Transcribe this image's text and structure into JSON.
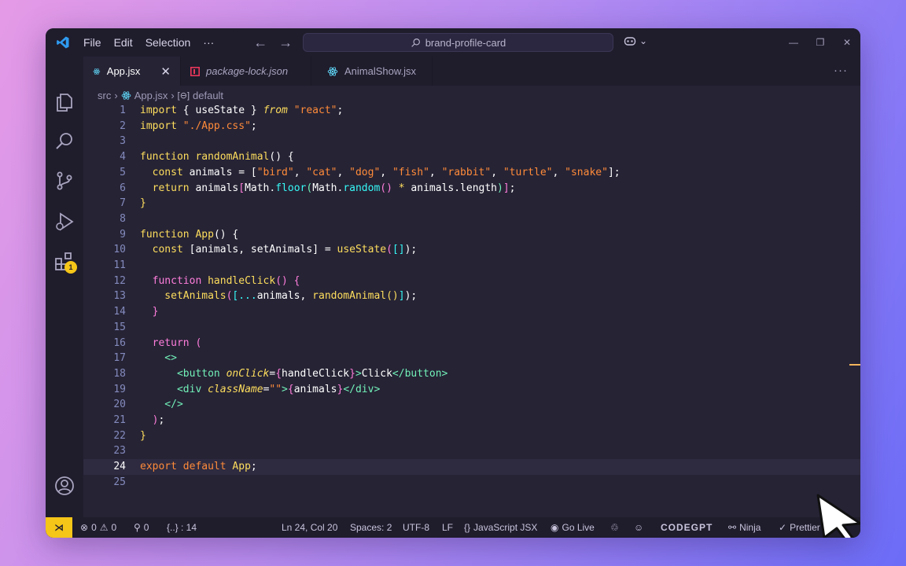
{
  "titlebar": {
    "menu": [
      "File",
      "Edit",
      "Selection",
      "···"
    ],
    "search_text": "brand-profile-card"
  },
  "activity_badge": "1",
  "tabs": [
    {
      "label": "App.jsx",
      "active": true,
      "icon": "react-icon"
    },
    {
      "label": "package-lock.json",
      "active": false,
      "icon": "npm-icon",
      "italic": true
    },
    {
      "label": "AnimalShow.jsx",
      "active": false,
      "icon": "react-icon"
    }
  ],
  "tab_more": "···",
  "breadcrumb": {
    "folder": "src",
    "file": "App.jsx",
    "symbol": "default"
  },
  "line_numbers": [
    "1",
    "2",
    "3",
    "4",
    "5",
    "6",
    "7",
    "8",
    "9",
    "10",
    "11",
    "12",
    "13",
    "14",
    "15",
    "16",
    "17",
    "18",
    "19",
    "20",
    "21",
    "22",
    "23",
    "24",
    "25"
  ],
  "code": {
    "l1_a": "import",
    "l1_b": " { ",
    "l1_c": "useState",
    "l1_d": " } ",
    "l1_e": "from",
    "l1_f": " ",
    "l1_g": "\"react\"",
    "l1_h": ";",
    "l2_a": "import",
    "l2_b": " ",
    "l2_c": "\"./App.css\"",
    "l2_d": ";",
    "l4_a": "function",
    "l4_b": " ",
    "l4_c": "randomAnimal",
    "l4_d": "() {",
    "l5_a": "  const",
    "l5_b": " ",
    "l5_c": "animals",
    "l5_d": " = [",
    "l5_e": "\"bird\"",
    "l5_f": ", ",
    "l5_g": "\"cat\"",
    "l5_h": ", ",
    "l5_i": "\"dog\"",
    "l5_j": ", ",
    "l5_k": "\"fish\"",
    "l5_l": ", ",
    "l5_m": "\"rabbit\"",
    "l5_n": ", ",
    "l5_o": "\"turtle\"",
    "l5_p": ", ",
    "l5_q": "\"snake\"",
    "l5_r": "];",
    "l6_a": "  return",
    "l6_b": " animals",
    "l6_c": "[",
    "l6_d": "Math",
    "l6_e": ".",
    "l6_f": "floor",
    "l6_g": "(",
    "l6_h": "Math",
    "l6_i": ".",
    "l6_j": "random",
    "l6_k": "() ",
    "l6_l": "*",
    "l6_m": " animals.length",
    "l6_n": ")",
    "l6_o": "]",
    "l6_p": ";",
    "l7_a": "}",
    "l9_a": "function",
    "l9_b": " ",
    "l9_c": "App",
    "l9_d": "() {",
    "l10_a": "  const",
    "l10_b": " [",
    "l10_c": "animals",
    "l10_d": ", ",
    "l10_e": "setAnimals",
    "l10_f": "] = ",
    "l10_g": "useState",
    "l10_h": "(",
    "l10_i": "[]",
    "l10_j": ");",
    "l12_a": "  function",
    "l12_b": " ",
    "l12_c": "handleClick",
    "l12_d": "() {",
    "l13_a": "    setAnimals",
    "l13_b": "(",
    "l13_c": "[...",
    "l13_d": "animals",
    "l13_e": ", ",
    "l13_f": "randomAnimal",
    "l13_g": "()",
    "l13_h": "]",
    "l13_i": ");",
    "l14_a": "  }",
    "l16_a": "  return",
    "l16_b": " (",
    "l17_a": "    <>",
    "l18_a": "      <button",
    "l18_b": " ",
    "l18_c": "onClick",
    "l18_d": "=",
    "l18_e": "{",
    "l18_f": "handleClick",
    "l18_g": "}",
    "l18_h": ">",
    "l18_i": "Click",
    "l18_j": "</button>",
    "l19_a": "      <div",
    "l19_b": " ",
    "l19_c": "className",
    "l19_d": "=",
    "l19_e": "\"\"",
    "l19_f": ">",
    "l19_g": "{",
    "l19_h": "animals",
    "l19_i": "}",
    "l19_j": "</div>",
    "l20_a": "    </>",
    "l21_a": "  )",
    "l21_b": ";",
    "l22_a": "}",
    "l24_a": "export",
    "l24_b": " ",
    "l24_c": "default",
    "l24_d": " ",
    "l24_e": "App",
    "l24_f": ";"
  },
  "status": {
    "errors": "0",
    "warnings": "0",
    "ports": "0",
    "symbols": "{..} : 14",
    "position": "Ln 24, Col 20",
    "spaces": "Spaces: 2",
    "encoding": "UTF-8",
    "eol": "LF",
    "language": "JavaScript JSX",
    "golive": "Go Live",
    "codegpt": "CODEGPT",
    "ninja": "Ninja",
    "prettier": "Prettier"
  },
  "colors": {
    "background": "#262335",
    "chrome": "#1f1c2c",
    "keyword": "#fede5d",
    "string": "#ff8b39",
    "function": "#36f9f6",
    "variable": "#ff7edb",
    "tag": "#72f1b8",
    "remote_badge": "#f5c518"
  }
}
